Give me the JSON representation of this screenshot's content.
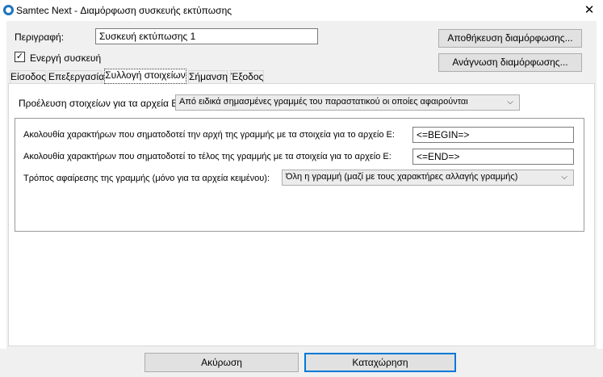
{
  "window": {
    "title": "Samtec Next - Διαμόρφωση συσκευής εκτύπωσης",
    "icon": "app-icon",
    "close_glyph": "✕"
  },
  "header": {
    "description_label": "Περιγραφή:",
    "description_value": "Συσκευή εκτύπωσης 1",
    "active_checkbox_label": "Ενεργή συσκευή",
    "active_checked": true,
    "checkmark": "✓",
    "save_config_label": "Αποθήκευση διαμόρφωσης...",
    "load_config_label": "Ανάγνωση διαμόρφωσης..."
  },
  "tabs": [
    {
      "label": "Είσοδος",
      "active": false
    },
    {
      "label": "Επεξεργασία",
      "active": false
    },
    {
      "label": "Συλλογή στοιχείων",
      "active": true
    },
    {
      "label": "Σήμανση",
      "active": false
    },
    {
      "label": "Έξοδος",
      "active": false
    }
  ],
  "data_collection": {
    "source_label": "Προέλευση στοιχείων για τα αρχεία Ε:",
    "source_value": "Από ειδικά σημασμένες γραμμές του παραστατικού οι οποίες αφαιρούνται",
    "begin_label": "Ακολουθία χαρακτήρων που σηματοδοτεί την αρχή της γραμμής με τα στοιχεία για το αρχείο Ε:",
    "begin_value": "<=BEGIN=>",
    "end_label": "Ακολουθία χαρακτήρων που σηματοδοτεί το τέλος της γραμμής με τα στοιχεία για το αρχείο Ε:",
    "end_value": "<=END=>",
    "removal_label": "Τρόπος αφαίρεσης της γραμμής (μόνο για τα αρχεία κειμένου):",
    "removal_value": "Όλη η γραμμή (μαζί με τους χαρακτήρες αλλαγής γραμμής)",
    "dropdown_glyph": "⌵"
  },
  "footer": {
    "cancel_label": "Ακύρωση",
    "submit_label": "Καταχώρηση"
  },
  "colors": {
    "panel_bg": "#f0f0f0",
    "accent": "#0078d7",
    "app_icon": "#1e73be"
  }
}
